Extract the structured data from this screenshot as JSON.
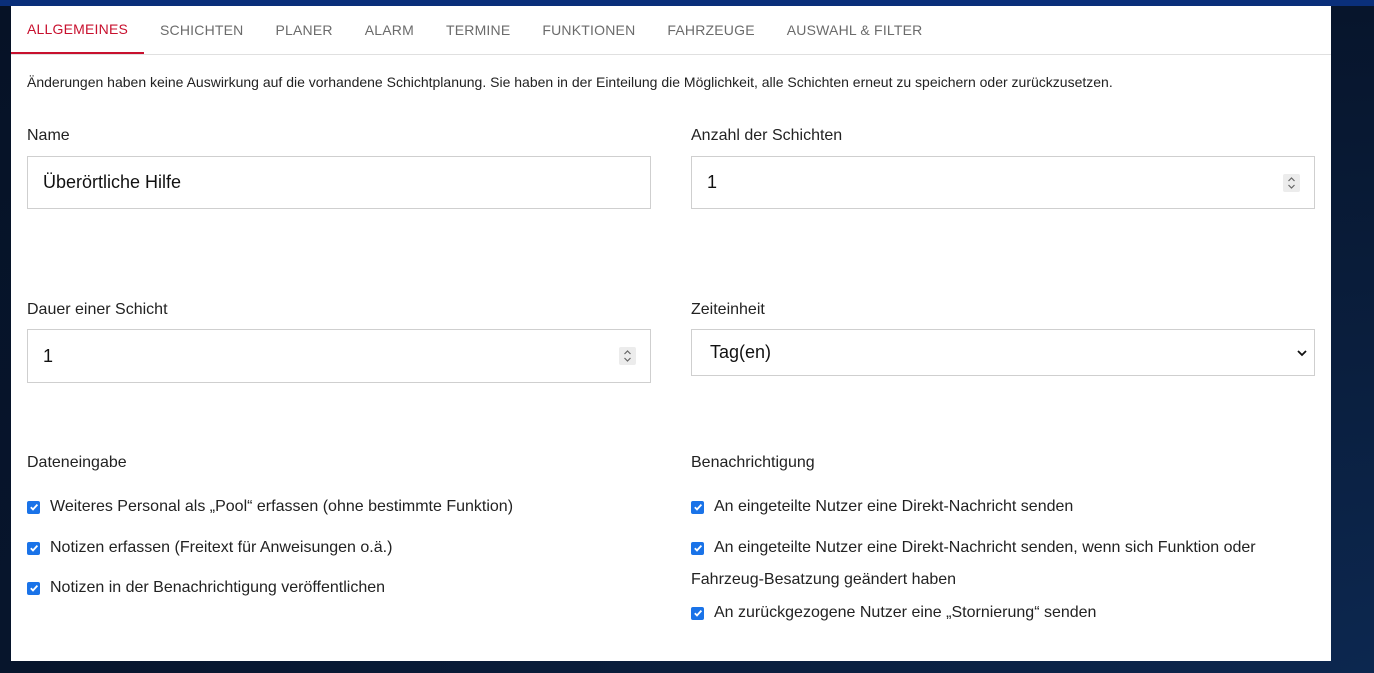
{
  "tabs": [
    {
      "label": "ALLGEMEINES",
      "active": true
    },
    {
      "label": "SCHICHTEN",
      "active": false
    },
    {
      "label": "PLANER",
      "active": false
    },
    {
      "label": "ALARM",
      "active": false
    },
    {
      "label": "TERMINE",
      "active": false
    },
    {
      "label": "FUNKTIONEN",
      "active": false
    },
    {
      "label": "FAHRZEUGE",
      "active": false
    },
    {
      "label": "AUSWAHL & FILTER",
      "active": false
    }
  ],
  "notice": "Änderungen haben keine Auswirkung auf die vorhandene Schichtplanung. Sie haben in der Einteilung die Möglichkeit, alle Schichten erneut zu speichern oder zurückzusetzen.",
  "form": {
    "name_label": "Name",
    "name_value": "Überörtliche Hilfe",
    "shift_count_label": "Anzahl der Schichten",
    "shift_count_value": "1",
    "shift_duration_label": "Dauer einer Schicht",
    "shift_duration_value": "1",
    "time_unit_label": "Zeiteinheit",
    "time_unit_value": "Tag(en)"
  },
  "data_entry": {
    "title": "Dateneingabe",
    "options": [
      {
        "label": "Weiteres Personal als „Pool“ erfassen (ohne bestimmte Funktion)",
        "checked": true
      },
      {
        "label": "Notizen erfassen (Freitext für Anweisungen o.ä.)",
        "checked": true
      },
      {
        "label": "Notizen in der Benachrichtigung veröffentlichen",
        "checked": true
      }
    ]
  },
  "notification": {
    "title": "Benachrichtigung",
    "option1": "An eingeteilte Nutzer eine Direkt-Nachricht senden",
    "option2_line1": "An eingeteilte Nutzer eine Direkt-Nachricht senden, wenn sich Funktion oder",
    "option2_line2": "Fahrzeug-Besatzung geändert haben",
    "option3": "An zurückgezogene Nutzer eine „Stornierung“ senden"
  },
  "colors": {
    "accent": "#c8102e",
    "checkbox": "#1a73e8",
    "background": "#07152c"
  }
}
